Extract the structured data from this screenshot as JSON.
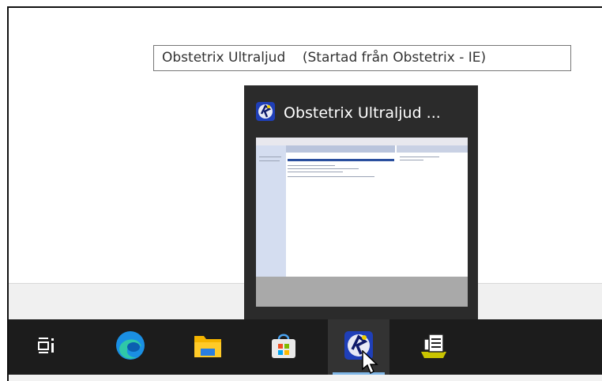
{
  "tooltip": {
    "app_name": "Obstetrix Ultraljud",
    "started_from": "(Startad från Obstetrix - IE)"
  },
  "preview": {
    "title": "Obstetrix Ultraljud ..."
  },
  "taskbar": {
    "items": [
      {
        "name": "task-view",
        "icon": "task-view-icon"
      },
      {
        "name": "edge",
        "icon": "edge-icon"
      },
      {
        "name": "file-explorer",
        "icon": "folder-icon"
      },
      {
        "name": "microsoft-store",
        "icon": "store-icon"
      },
      {
        "name": "obstetrix",
        "icon": "obstetrix-icon",
        "active": true
      },
      {
        "name": "notes-app",
        "icon": "notepad-icon"
      }
    ]
  },
  "colors": {
    "taskbar": "#1c1c1c",
    "preview_bg": "#2b2b2b",
    "active_indicator": "#7fb6e6"
  }
}
